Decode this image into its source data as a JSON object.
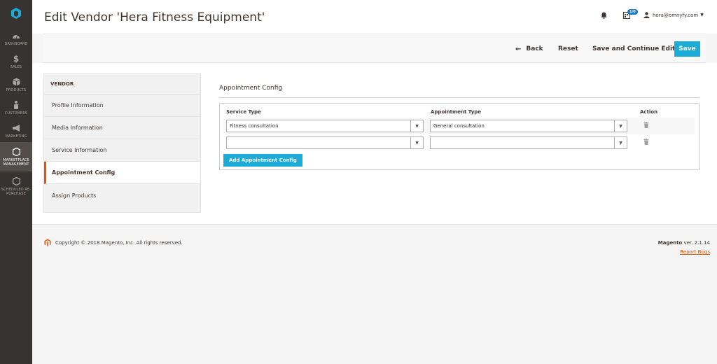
{
  "sidebar": {
    "items": [
      {
        "label": "DASHBOARD",
        "icon": "dashboard-icon"
      },
      {
        "label": "SALES",
        "icon": "dollar-icon"
      },
      {
        "label": "PRODUCTS",
        "icon": "cube-icon"
      },
      {
        "label": "CUSTOMERS",
        "icon": "person-icon"
      },
      {
        "label": "MARKETING",
        "icon": "megaphone-icon"
      },
      {
        "label": "MARKETPLACE MANAGEMENT",
        "icon": "hexagon-icon"
      },
      {
        "label": "SCHEDULED RE-PURCHASE",
        "icon": "hexagon-icon"
      }
    ]
  },
  "header": {
    "title": "Edit Vendor 'Hera Fitness Equipment'",
    "notification_badge": "1/0",
    "user": "hera@omnyfy.com"
  },
  "actions": {
    "back": "Back",
    "reset": "Reset",
    "save_continue": "Save and Continue Edit",
    "save": "Save"
  },
  "tabs": {
    "heading": "VENDOR",
    "items": [
      "Profile Information",
      "Media Information",
      "Service Information",
      "Appointment Config",
      "Assign Products"
    ]
  },
  "section": {
    "title": "Appointment Config",
    "columns": [
      "Service Type",
      "Appointment Type",
      "Action"
    ],
    "rows": [
      {
        "service": "Fitness consultation",
        "appointment": "General consultation"
      },
      {
        "service": "",
        "appointment": ""
      }
    ],
    "add_button": "Add Appointment Config"
  },
  "footer": {
    "copyright": "Copyright © 2018 Magento, Inc. All rights reserved.",
    "brand": "Magento",
    "version": "ver. 2.1.14",
    "report": "Report Bugs"
  },
  "colors": {
    "accent": "#1bacd8",
    "sidebar": "#373330",
    "active_tab": "#eb5202"
  }
}
